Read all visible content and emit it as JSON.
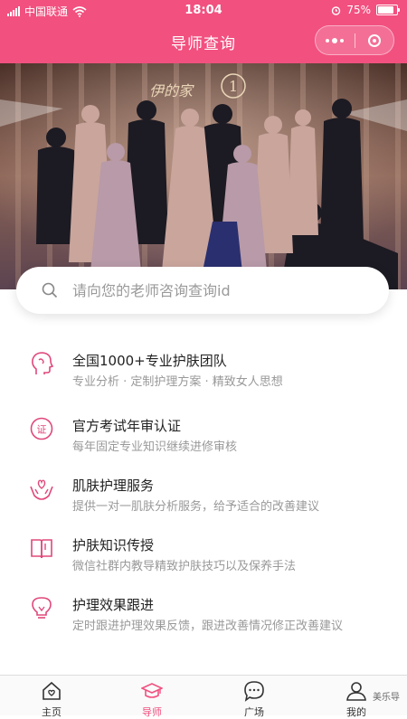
{
  "status_bar": {
    "carrier": "中国联通",
    "time": "18:04",
    "battery": "75%",
    "battery_level": 0.75
  },
  "header": {
    "title": "导师查询",
    "menu_icon": "more-dots-icon",
    "close_icon": "target-circle-icon"
  },
  "banner": {
    "logo_text": "伊的家"
  },
  "search": {
    "placeholder": "请向您的老师咨询查询id"
  },
  "features": [
    {
      "icon": "head-silhouette-icon",
      "title": "全国1000+专业护肤团队",
      "desc": "专业分析 · 定制护理方案 · 精致女人思想"
    },
    {
      "icon": "certificate-seal-icon",
      "title": "官方考试年审认证",
      "desc": "每年固定专业知识继续进修审核"
    },
    {
      "icon": "caring-hands-icon",
      "title": "肌肤护理服务",
      "desc": "提供一对一肌肤分析服务，给予适合的改善建议"
    },
    {
      "icon": "open-book-icon",
      "title": "护肤知识传授",
      "desc": "微信社群内教导精致护肤技巧以及保养手法"
    },
    {
      "icon": "lightbulb-icon",
      "title": "护理效果跟进",
      "desc": "定时跟进护理效果反馈，跟进改善情况修正改善建议"
    }
  ],
  "tabs": [
    {
      "label": "主页",
      "icon": "home-icon"
    },
    {
      "label": "导师",
      "icon": "graduation-cap-icon",
      "active": true
    },
    {
      "label": "广场",
      "icon": "chat-bubble-icon"
    },
    {
      "label": "我的",
      "icon": "user-icon"
    }
  ],
  "watermark": "美乐导",
  "colors": {
    "accent": "#f2507f",
    "text_primary": "#222222",
    "text_secondary": "#999999"
  }
}
